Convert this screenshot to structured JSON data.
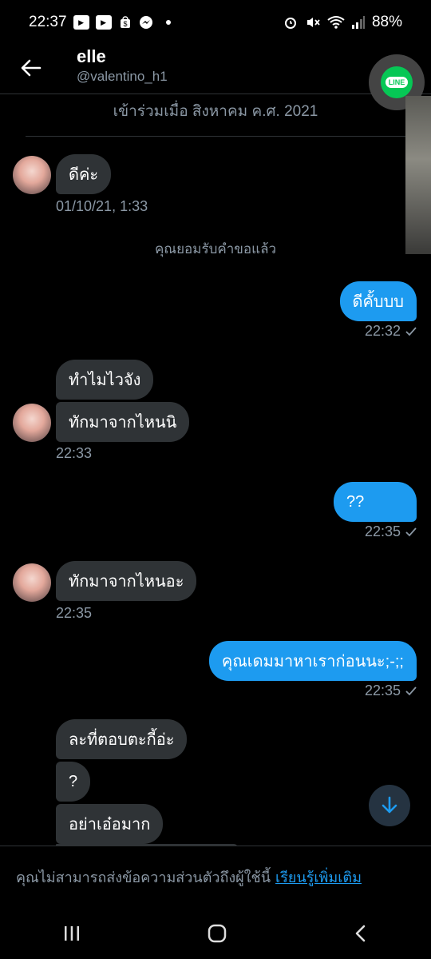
{
  "status_bar": {
    "time": "22:37",
    "battery": "88%",
    "icons": [
      "youtube-icon",
      "youtube-icon",
      "shopping-icon",
      "messenger-icon",
      "alarm-icon",
      "mute-icon",
      "wifi-icon",
      "signal-icon",
      "battery-icon"
    ]
  },
  "header": {
    "name": "elle",
    "handle": "@valentino_h1",
    "back_icon": "arrow-left-icon"
  },
  "floating_app": {
    "icon": "line-icon",
    "label": "LINE"
  },
  "joined_text": "เข้าร่วมเมื่อ สิงหาคม ค.ศ. 2021",
  "messages": [
    {
      "text": "ดีค่ะ"
    },
    {
      "meta": "01/10/21, 1:33"
    },
    {
      "system": "คุณยอมรับคำขอแล้ว"
    },
    {
      "text": "ดีคั้บบบ",
      "time": "22:32"
    },
    {
      "text": "ทำไมไวจัง"
    },
    {
      "text": "ทักมาจากไหนนิ",
      "time": "22:33"
    },
    {
      "text": "??",
      "time": "22:35"
    },
    {
      "text": "ทักมาจากไหนอะ",
      "time": "22:35"
    },
    {
      "text": "คุณเดมมาหาเราก่อนนะ;-;;",
      "time": "22:35"
    },
    {
      "text": "ละที่ตอบตะกี้อ่ะ"
    },
    {
      "text": "?"
    },
    {
      "text": "อย่าเอ๋อมาก"
    }
  ],
  "footer": {
    "text": "คุณไม่สามารถส่งข้อความส่วนตัวถึงผู้ใช้นี้",
    "link": "เรียนรู้เพิ่มเติม"
  },
  "colors": {
    "accent": "#1d9bf0",
    "incoming_bubble": "#2f3336",
    "muted": "#8b98a5",
    "background": "#000000"
  }
}
